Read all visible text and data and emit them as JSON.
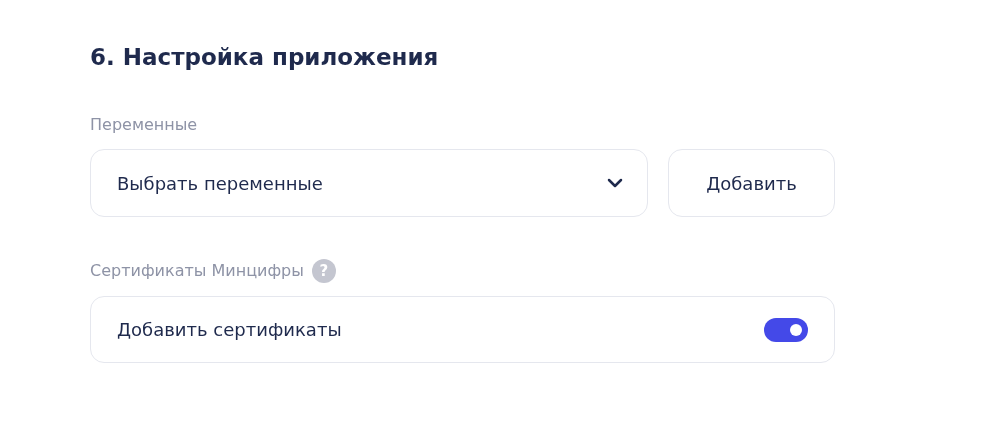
{
  "title": "6. Настройка приложения",
  "variables": {
    "label": "Переменные",
    "select": {
      "value": "Выбрать переменные"
    },
    "button": "Добавить"
  },
  "certificates": {
    "label": "Сертификаты Минцифры",
    "help_icon": "?",
    "toggle": {
      "label": "Добавить сертификаты",
      "on": true
    }
  }
}
